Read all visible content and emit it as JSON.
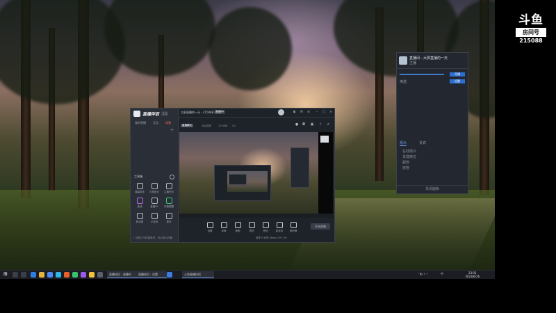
{
  "logo": {
    "mark": "斗鱼",
    "room_label": "房间号",
    "room_id": "215088"
  },
  "app": {
    "brand": "直播伴侣",
    "version": "5.0",
    "left_tabs": [
      "我的直播",
      "互动",
      "场景"
    ],
    "active_tab": 2,
    "tools_title": "工具箱",
    "tools": [
      "弹幕助手",
      "礼物统计",
      "主播任务",
      "连线",
      "直播PK",
      "开播提醒",
      "粉丝团",
      "小游戏",
      "更多"
    ],
    "status_text": "✓ 当前CPU性能良好，可以放心开播",
    "room_title": "大屏直播的一天 - 215088",
    "live_tag": "直播中",
    "sub_tag": "直播模式",
    "sub_items": [
      "分区选择",
      "215088",
      "0人"
    ],
    "bottom_tools": [
      "设置",
      "录像",
      "美颜",
      "滤镜",
      "音效",
      "麦克风",
      "扬声器"
    ],
    "go_live": "开始直播",
    "bottom_status": "帧率 0  码率 0kbps  CPU 0%"
  },
  "right_panel": {
    "title": "直播间 - 大屏直播的一天",
    "sub": "主播",
    "buttons": [
      "开播",
      "设置"
    ],
    "search_label": "筛选",
    "tabs": [
      "观众",
      "贵宾"
    ],
    "active_tab": 0,
    "list": [
      "在线观众",
      "贵宾席位",
      "超管",
      "房管"
    ],
    "footer": "关闭面板"
  },
  "taskbar": {
    "apps": [
      "直播伴侣 - 直播中",
      "直播伴侣 - 设置",
      "斗鱼直播伴侣"
    ],
    "clock_time": "23:01",
    "clock_date": "2023/6/16",
    "tray": "中"
  },
  "colors": {
    "accent": "#ff6b5a",
    "link_blue": "#6aa0f0",
    "panel_bg": "#23272f"
  }
}
